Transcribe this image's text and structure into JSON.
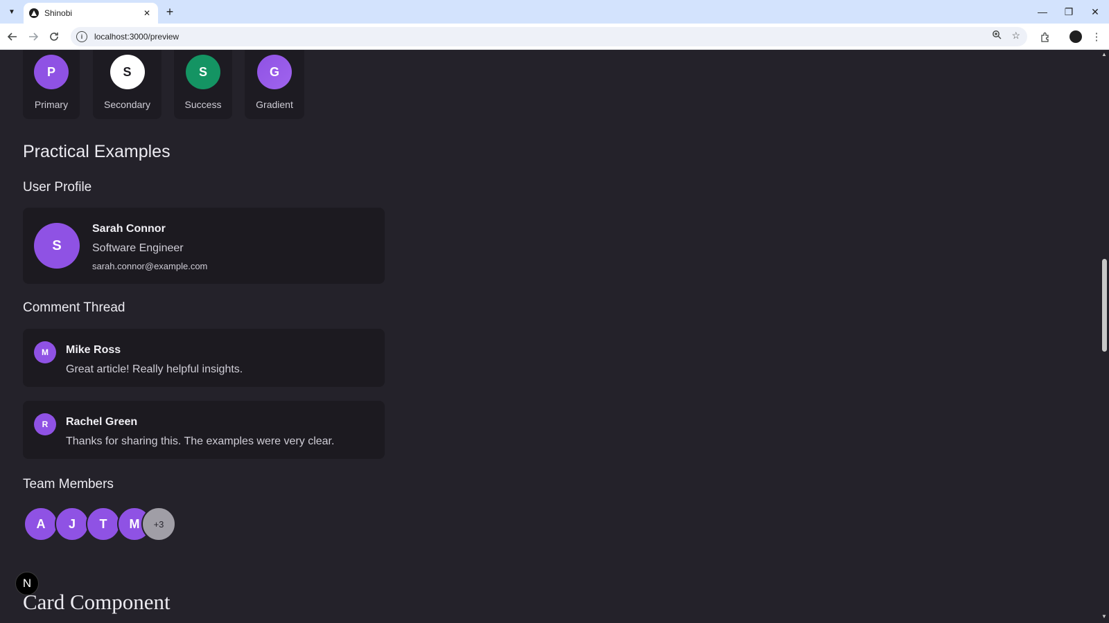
{
  "browser": {
    "tab_title": "Shinobi",
    "url": "localhost:3000/preview",
    "tab_close": "✕",
    "new_tab": "+",
    "minimize": "—",
    "restore": "❐",
    "close": "✕",
    "icons": [
      "tab-list-icon",
      "back-icon",
      "forward-icon",
      "reload-icon",
      "site-info-icon",
      "zoom-icon",
      "star-icon",
      "extensions-icon",
      "profile-icon",
      "menu-icon"
    ]
  },
  "variants": [
    {
      "initial": "P",
      "label": "Primary",
      "bg": "#8f52e4",
      "fg": "#ffffff"
    },
    {
      "initial": "S",
      "label": "Secondary",
      "bg": "#ffffff",
      "fg": "#1c1a20"
    },
    {
      "initial": "S",
      "label": "Success",
      "bg": "#149463",
      "fg": "#ffffff"
    },
    {
      "initial": "G",
      "label": "Gradient",
      "bg": "#8f52e4",
      "fg": "#ffffff"
    }
  ],
  "practical": {
    "title": "Practical Examples",
    "user_profile": {
      "heading": "User Profile",
      "initial": "S",
      "name": "Sarah Connor",
      "role": "Software Engineer",
      "email": "sarah.connor@example.com"
    },
    "comment_thread": {
      "heading": "Comment Thread",
      "comments": [
        {
          "initial": "M",
          "author": "Mike Ross",
          "text": "Great article! Really helpful insights."
        },
        {
          "initial": "R",
          "author": "Rachel Green",
          "text": "Thanks for sharing this. The examples were very clear."
        }
      ]
    },
    "team_members": {
      "heading": "Team Members",
      "avatars": [
        "A",
        "J",
        "T",
        "M"
      ],
      "more": "+3"
    }
  },
  "next_badge": "N",
  "card_component_heading": "Card Component",
  "colors": {
    "page_bg": "#24222a",
    "panel_bg": "#1c1a20",
    "accent_purple": "#8f52e4",
    "success_green": "#149463"
  }
}
